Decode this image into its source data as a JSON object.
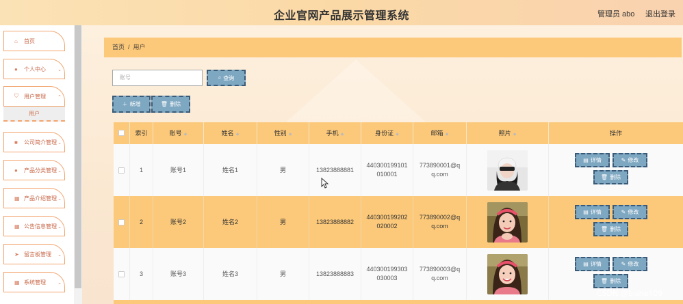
{
  "header": {
    "title": "企业官网产品展示管理系统",
    "user_label": "管理员 abo",
    "logout_label": "退出登录"
  },
  "sidebar": {
    "items": [
      {
        "label": "首页",
        "icon": "home-icon"
      },
      {
        "label": "个人中心",
        "icon": "person-icon"
      },
      {
        "label": "用户管理",
        "icon": "shield-icon"
      },
      {
        "label": "公司简介管理",
        "icon": "book-icon"
      },
      {
        "label": "产品分类管理",
        "icon": "person-icon"
      },
      {
        "label": "产品介绍管理",
        "icon": "grid-icon"
      },
      {
        "label": "公告信息管理",
        "icon": "grid-icon"
      },
      {
        "label": "留言板管理",
        "icon": "send-icon"
      },
      {
        "label": "系统管理",
        "icon": "grid-icon"
      }
    ],
    "submenu": {
      "label": "用户"
    }
  },
  "breadcrumb": {
    "home": "首页",
    "separator": "/",
    "current": "用户"
  },
  "search": {
    "placeholder": "账号",
    "query_label": "查询"
  },
  "toolbar": {
    "add_label": "新增",
    "delete_label": "删除"
  },
  "table": {
    "columns": [
      "索引",
      "账号",
      "姓名",
      "性别",
      "手机",
      "身份证",
      "邮箱",
      "照片",
      "操作"
    ],
    "rows": [
      {
        "index": "1",
        "account": "账号1",
        "name": "姓名1",
        "gender": "男",
        "phone": "13823888881",
        "id_card": "440300199101010001",
        "email": "773890001@qq.com"
      },
      {
        "index": "2",
        "account": "账号2",
        "name": "姓名2",
        "gender": "男",
        "phone": "13823888882",
        "id_card": "440300199202020002",
        "email": "773890002@qq.com"
      },
      {
        "index": "3",
        "account": "账号3",
        "name": "姓名3",
        "gender": "男",
        "phone": "13823888883",
        "id_card": "440300199303030003",
        "email": "773890003@qq.com"
      }
    ],
    "actions": {
      "detail": "详情",
      "edit": "修改",
      "delete": "删除"
    }
  },
  "watermark": "CSDN @bishe409",
  "colors": {
    "accent": "#fcc97a",
    "button": "#7ea7c1",
    "button_border": "#3a5a78",
    "menu_border": "#f2a36b"
  }
}
